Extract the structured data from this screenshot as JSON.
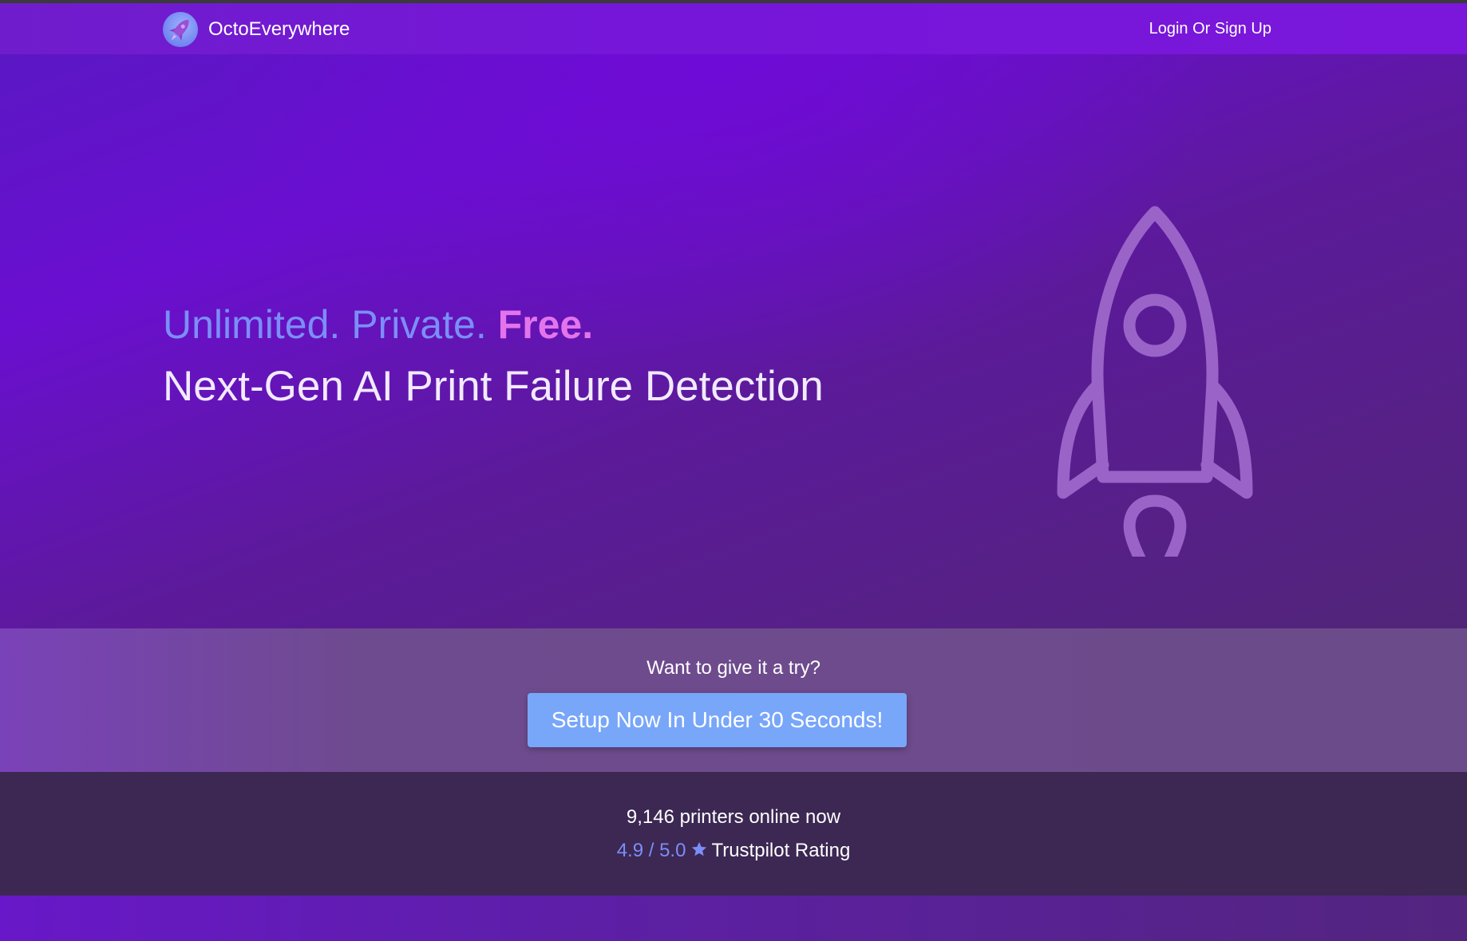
{
  "nav": {
    "brand": "OctoEverywhere",
    "login_label": "Login Or Sign Up",
    "logo_icon": "rocket-logo-icon"
  },
  "hero": {
    "tagline_part1": "Unlimited.",
    "tagline_part2": "Private.",
    "tagline_part3": "Free.",
    "headline": "Next-Gen AI Print Failure Detection",
    "illustration_icon": "rocket-icon"
  },
  "cta": {
    "question": "Want to give it a try?",
    "button_label": "Setup Now In Under 30 Seconds!"
  },
  "stats": {
    "printers_online": "9,146 printers online now",
    "rating_value": "4.9 / 5.0",
    "rating_icon": "star-icon",
    "rating_label": "Trustpilot Rating"
  },
  "colors": {
    "nav_bg": "#7616d9",
    "accent_blue": "#7b8ef8",
    "accent_pink": "#e374ec",
    "button_bg": "#78a6f9",
    "stats_bg": "#3c2853"
  }
}
